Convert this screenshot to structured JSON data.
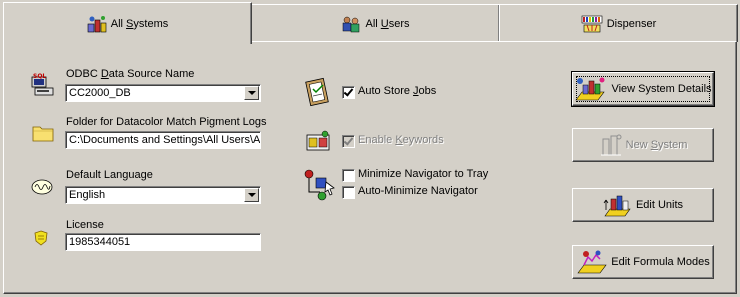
{
  "tabs": [
    {
      "label_pre": "All ",
      "label_u": "S",
      "label_post": "ystems",
      "icon": "systems-icon"
    },
    {
      "label_pre": "All ",
      "label_u": "U",
      "label_post": "sers",
      "icon": "users-icon"
    },
    {
      "label_pre": "",
      "label_u": "",
      "label_post": "Dispenser",
      "icon": "dispenser-icon"
    }
  ],
  "odbc": {
    "label_pre": "ODBC ",
    "label_u": "D",
    "label_post": "ata Source Name",
    "value": "CC2000_DB"
  },
  "folder": {
    "label": "Folder for Datacolor Match Pigment Logs",
    "value": "C:\\Documents and Settings\\All Users\\A"
  },
  "language": {
    "label": "Default Language",
    "value": "English"
  },
  "license": {
    "label": "License",
    "value": "1985344051"
  },
  "checks": {
    "auto_store": {
      "pre": "Auto Store ",
      "u": "J",
      "post": "obs",
      "checked": true,
      "enabled": true
    },
    "enable_keywords": {
      "pre": "Enable ",
      "u": "K",
      "post": "eywords",
      "checked": true,
      "enabled": false
    },
    "minimize_tray": {
      "label": "Minimize Navigator to Tray",
      "checked": false
    },
    "auto_minimize": {
      "label": "Auto-Minimize Navigator",
      "checked": false
    }
  },
  "buttons": {
    "view_system": "View System Details",
    "new_system_pre": "New ",
    "new_system_u": "S",
    "new_system_post": "ystem",
    "edit_units": "Edit Units",
    "edit_formula": "Edit Formula Modes"
  },
  "colors": {
    "face": "#d4d0c8",
    "disabled": "#808080"
  }
}
